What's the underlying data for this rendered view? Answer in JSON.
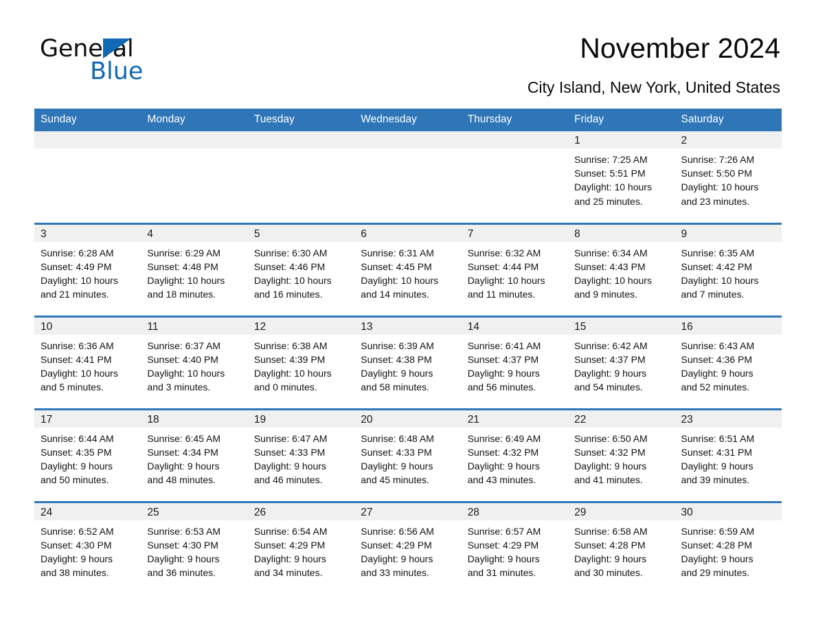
{
  "brand": {
    "name_part1": "General",
    "name_part2": "Blue",
    "accent_color": "#1268b3"
  },
  "header": {
    "title": "November 2024",
    "location": "City Island, New York, United States"
  },
  "theme": {
    "header_blue": "#2e76b8",
    "date_strip_gray": "#f0f0f0",
    "text_color": "#111111"
  },
  "weekdays": [
    "Sunday",
    "Monday",
    "Tuesday",
    "Wednesday",
    "Thursday",
    "Friday",
    "Saturday"
  ],
  "weeks": [
    [
      {
        "date": "",
        "sunrise": "",
        "sunset": "",
        "daylight_line1": "",
        "daylight_line2": "",
        "empty": true
      },
      {
        "date": "",
        "sunrise": "",
        "sunset": "",
        "daylight_line1": "",
        "daylight_line2": "",
        "empty": true
      },
      {
        "date": "",
        "sunrise": "",
        "sunset": "",
        "daylight_line1": "",
        "daylight_line2": "",
        "empty": true
      },
      {
        "date": "",
        "sunrise": "",
        "sunset": "",
        "daylight_line1": "",
        "daylight_line2": "",
        "empty": true
      },
      {
        "date": "",
        "sunrise": "",
        "sunset": "",
        "daylight_line1": "",
        "daylight_line2": "",
        "empty": true
      },
      {
        "date": "1",
        "sunrise": "Sunrise: 7:25 AM",
        "sunset": "Sunset: 5:51 PM",
        "daylight_line1": "Daylight: 10 hours",
        "daylight_line2": "and 25 minutes.",
        "empty": false
      },
      {
        "date": "2",
        "sunrise": "Sunrise: 7:26 AM",
        "sunset": "Sunset: 5:50 PM",
        "daylight_line1": "Daylight: 10 hours",
        "daylight_line2": "and 23 minutes.",
        "empty": false
      }
    ],
    [
      {
        "date": "3",
        "sunrise": "Sunrise: 6:28 AM",
        "sunset": "Sunset: 4:49 PM",
        "daylight_line1": "Daylight: 10 hours",
        "daylight_line2": "and 21 minutes.",
        "empty": false
      },
      {
        "date": "4",
        "sunrise": "Sunrise: 6:29 AM",
        "sunset": "Sunset: 4:48 PM",
        "daylight_line1": "Daylight: 10 hours",
        "daylight_line2": "and 18 minutes.",
        "empty": false
      },
      {
        "date": "5",
        "sunrise": "Sunrise: 6:30 AM",
        "sunset": "Sunset: 4:46 PM",
        "daylight_line1": "Daylight: 10 hours",
        "daylight_line2": "and 16 minutes.",
        "empty": false
      },
      {
        "date": "6",
        "sunrise": "Sunrise: 6:31 AM",
        "sunset": "Sunset: 4:45 PM",
        "daylight_line1": "Daylight: 10 hours",
        "daylight_line2": "and 14 minutes.",
        "empty": false
      },
      {
        "date": "7",
        "sunrise": "Sunrise: 6:32 AM",
        "sunset": "Sunset: 4:44 PM",
        "daylight_line1": "Daylight: 10 hours",
        "daylight_line2": "and 11 minutes.",
        "empty": false
      },
      {
        "date": "8",
        "sunrise": "Sunrise: 6:34 AM",
        "sunset": "Sunset: 4:43 PM",
        "daylight_line1": "Daylight: 10 hours",
        "daylight_line2": "and 9 minutes.",
        "empty": false
      },
      {
        "date": "9",
        "sunrise": "Sunrise: 6:35 AM",
        "sunset": "Sunset: 4:42 PM",
        "daylight_line1": "Daylight: 10 hours",
        "daylight_line2": "and 7 minutes.",
        "empty": false
      }
    ],
    [
      {
        "date": "10",
        "sunrise": "Sunrise: 6:36 AM",
        "sunset": "Sunset: 4:41 PM",
        "daylight_line1": "Daylight: 10 hours",
        "daylight_line2": "and 5 minutes.",
        "empty": false
      },
      {
        "date": "11",
        "sunrise": "Sunrise: 6:37 AM",
        "sunset": "Sunset: 4:40 PM",
        "daylight_line1": "Daylight: 10 hours",
        "daylight_line2": "and 3 minutes.",
        "empty": false
      },
      {
        "date": "12",
        "sunrise": "Sunrise: 6:38 AM",
        "sunset": "Sunset: 4:39 PM",
        "daylight_line1": "Daylight: 10 hours",
        "daylight_line2": "and 0 minutes.",
        "empty": false
      },
      {
        "date": "13",
        "sunrise": "Sunrise: 6:39 AM",
        "sunset": "Sunset: 4:38 PM",
        "daylight_line1": "Daylight: 9 hours",
        "daylight_line2": "and 58 minutes.",
        "empty": false
      },
      {
        "date": "14",
        "sunrise": "Sunrise: 6:41 AM",
        "sunset": "Sunset: 4:37 PM",
        "daylight_line1": "Daylight: 9 hours",
        "daylight_line2": "and 56 minutes.",
        "empty": false
      },
      {
        "date": "15",
        "sunrise": "Sunrise: 6:42 AM",
        "sunset": "Sunset: 4:37 PM",
        "daylight_line1": "Daylight: 9 hours",
        "daylight_line2": "and 54 minutes.",
        "empty": false
      },
      {
        "date": "16",
        "sunrise": "Sunrise: 6:43 AM",
        "sunset": "Sunset: 4:36 PM",
        "daylight_line1": "Daylight: 9 hours",
        "daylight_line2": "and 52 minutes.",
        "empty": false
      }
    ],
    [
      {
        "date": "17",
        "sunrise": "Sunrise: 6:44 AM",
        "sunset": "Sunset: 4:35 PM",
        "daylight_line1": "Daylight: 9 hours",
        "daylight_line2": "and 50 minutes.",
        "empty": false
      },
      {
        "date": "18",
        "sunrise": "Sunrise: 6:45 AM",
        "sunset": "Sunset: 4:34 PM",
        "daylight_line1": "Daylight: 9 hours",
        "daylight_line2": "and 48 minutes.",
        "empty": false
      },
      {
        "date": "19",
        "sunrise": "Sunrise: 6:47 AM",
        "sunset": "Sunset: 4:33 PM",
        "daylight_line1": "Daylight: 9 hours",
        "daylight_line2": "and 46 minutes.",
        "empty": false
      },
      {
        "date": "20",
        "sunrise": "Sunrise: 6:48 AM",
        "sunset": "Sunset: 4:33 PM",
        "daylight_line1": "Daylight: 9 hours",
        "daylight_line2": "and 45 minutes.",
        "empty": false
      },
      {
        "date": "21",
        "sunrise": "Sunrise: 6:49 AM",
        "sunset": "Sunset: 4:32 PM",
        "daylight_line1": "Daylight: 9 hours",
        "daylight_line2": "and 43 minutes.",
        "empty": false
      },
      {
        "date": "22",
        "sunrise": "Sunrise: 6:50 AM",
        "sunset": "Sunset: 4:32 PM",
        "daylight_line1": "Daylight: 9 hours",
        "daylight_line2": "and 41 minutes.",
        "empty": false
      },
      {
        "date": "23",
        "sunrise": "Sunrise: 6:51 AM",
        "sunset": "Sunset: 4:31 PM",
        "daylight_line1": "Daylight: 9 hours",
        "daylight_line2": "and 39 minutes.",
        "empty": false
      }
    ],
    [
      {
        "date": "24",
        "sunrise": "Sunrise: 6:52 AM",
        "sunset": "Sunset: 4:30 PM",
        "daylight_line1": "Daylight: 9 hours",
        "daylight_line2": "and 38 minutes.",
        "empty": false
      },
      {
        "date": "25",
        "sunrise": "Sunrise: 6:53 AM",
        "sunset": "Sunset: 4:30 PM",
        "daylight_line1": "Daylight: 9 hours",
        "daylight_line2": "and 36 minutes.",
        "empty": false
      },
      {
        "date": "26",
        "sunrise": "Sunrise: 6:54 AM",
        "sunset": "Sunset: 4:29 PM",
        "daylight_line1": "Daylight: 9 hours",
        "daylight_line2": "and 34 minutes.",
        "empty": false
      },
      {
        "date": "27",
        "sunrise": "Sunrise: 6:56 AM",
        "sunset": "Sunset: 4:29 PM",
        "daylight_line1": "Daylight: 9 hours",
        "daylight_line2": "and 33 minutes.",
        "empty": false
      },
      {
        "date": "28",
        "sunrise": "Sunrise: 6:57 AM",
        "sunset": "Sunset: 4:29 PM",
        "daylight_line1": "Daylight: 9 hours",
        "daylight_line2": "and 31 minutes.",
        "empty": false
      },
      {
        "date": "29",
        "sunrise": "Sunrise: 6:58 AM",
        "sunset": "Sunset: 4:28 PM",
        "daylight_line1": "Daylight: 9 hours",
        "daylight_line2": "and 30 minutes.",
        "empty": false
      },
      {
        "date": "30",
        "sunrise": "Sunrise: 6:59 AM",
        "sunset": "Sunset: 4:28 PM",
        "daylight_line1": "Daylight: 9 hours",
        "daylight_line2": "and 29 minutes.",
        "empty": false
      }
    ]
  ]
}
